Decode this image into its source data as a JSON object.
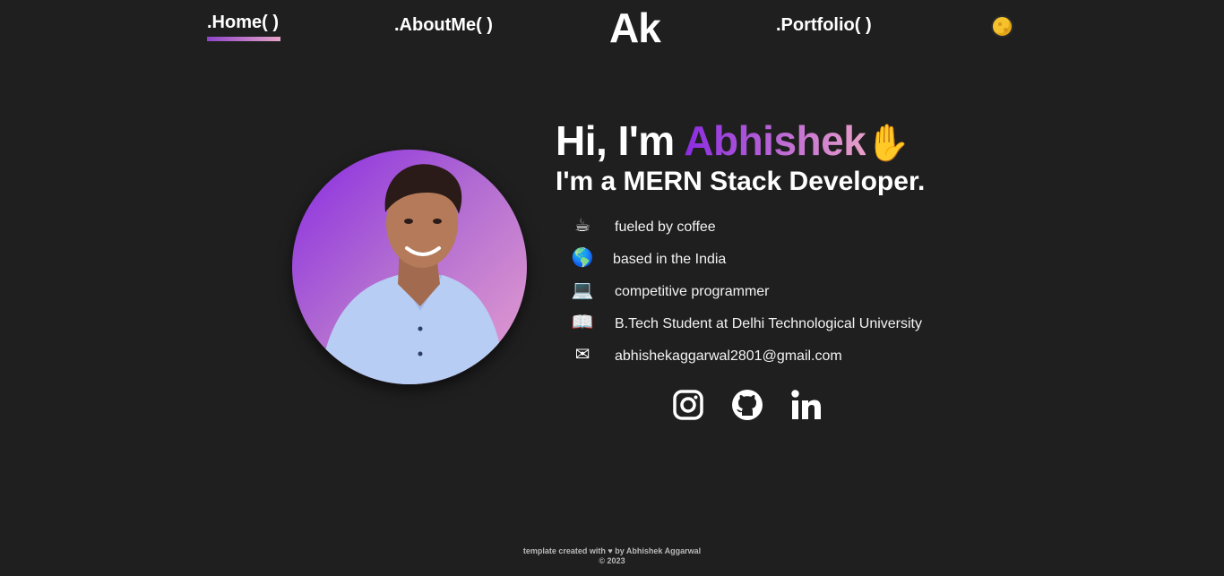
{
  "nav": {
    "home_label": ".Home( )",
    "about_label": ".AboutMe( )",
    "logo": "Ak",
    "portfolio_label": ".Portfolio( )",
    "theme_toggle_icon": "sun-icon"
  },
  "intro": {
    "greeting_prefix": "Hi, I'm ",
    "name": "Abhishek",
    "wave_emoji": "✋",
    "role": "I'm a MERN Stack Developer."
  },
  "facts": [
    {
      "icon": "coffee-icon",
      "emoji": "☕",
      "text": "fueled by coffee"
    },
    {
      "icon": "globe-icon",
      "emoji": "🌎",
      "text": "based in the India"
    },
    {
      "icon": "laptop-icon",
      "emoji": "💻",
      "text": "competitive programmer"
    },
    {
      "icon": "book-icon",
      "emoji": "📖",
      "text": "B.Tech Student at Delhi Technological University"
    },
    {
      "icon": "mail-icon",
      "emoji": "✉",
      "text": "abhishekaggarwal2801@gmail.com"
    }
  ],
  "social": [
    {
      "icon": "instagram-icon"
    },
    {
      "icon": "github-icon"
    },
    {
      "icon": "linkedin-icon"
    }
  ],
  "footer": {
    "line1": "template created with ♥ by Abhishek Aggarwal",
    "line2": "© 2023"
  },
  "colors": {
    "background": "#1f1f1f",
    "accent_start": "#8a2be2",
    "accent_end": "#e8a0c8",
    "text": "#ffffff"
  }
}
